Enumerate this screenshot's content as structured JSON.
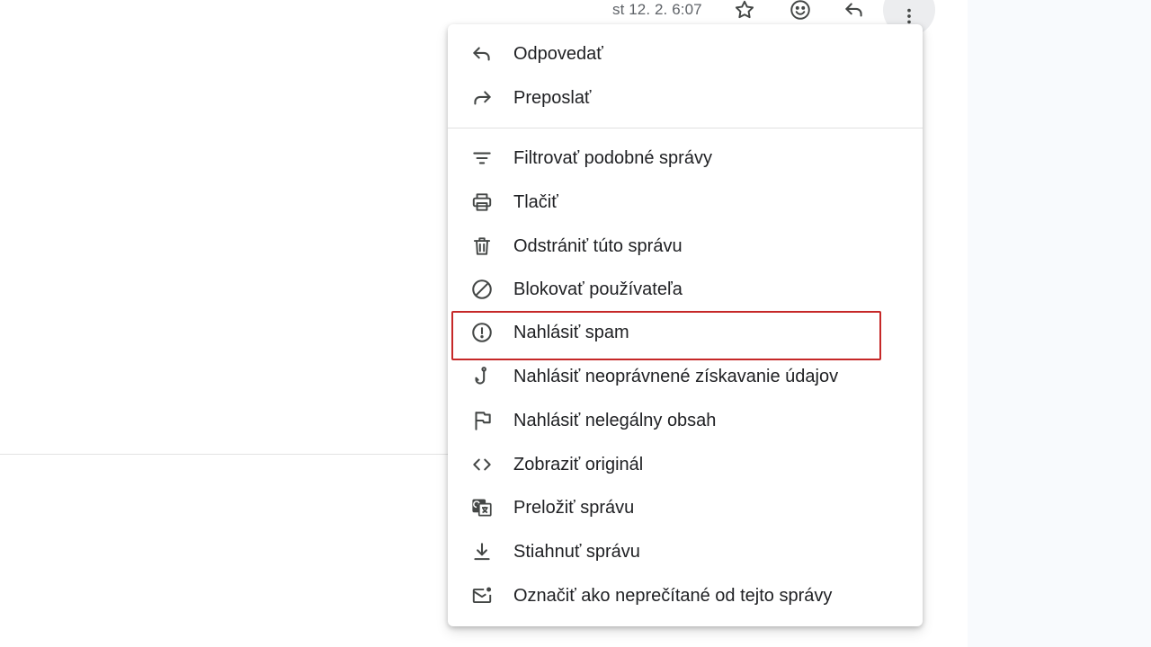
{
  "header": {
    "timestamp": "st 12. 2. 6:07",
    "icons": [
      "star-icon",
      "emoji-icon",
      "reply-icon",
      "more-vert-icon"
    ]
  },
  "menu": {
    "items": [
      {
        "label": "Odpovedať",
        "icon": "reply-icon"
      },
      {
        "label": "Preposlať",
        "icon": "forward-icon"
      },
      {
        "label": "Filtrovať podobné správy",
        "icon": "filter-icon"
      },
      {
        "label": "Tlačiť",
        "icon": "print-icon"
      },
      {
        "label": "Odstrániť túto správu",
        "icon": "trash-icon"
      },
      {
        "label": "Blokovať používateľa",
        "icon": "block-icon"
      },
      {
        "label": "Nahlásiť spam",
        "icon": "report-spam-icon"
      },
      {
        "label": "Nahlásiť neoprávnené získavanie údajov",
        "icon": "phishing-hook-icon"
      },
      {
        "label": "Nahlásiť nelegálny obsah",
        "icon": "flag-icon"
      },
      {
        "label": "Zobraziť originál",
        "icon": "code-icon"
      },
      {
        "label": "Preložiť správu",
        "icon": "translate-icon"
      },
      {
        "label": "Stiahnuť správu",
        "icon": "download-icon"
      },
      {
        "label": "Označiť ako neprečítané od tejto správy",
        "icon": "mark-unread-icon"
      }
    ]
  },
  "colors": {
    "highlight_border": "#c62828",
    "icon": "#444746",
    "text": "#202124"
  }
}
